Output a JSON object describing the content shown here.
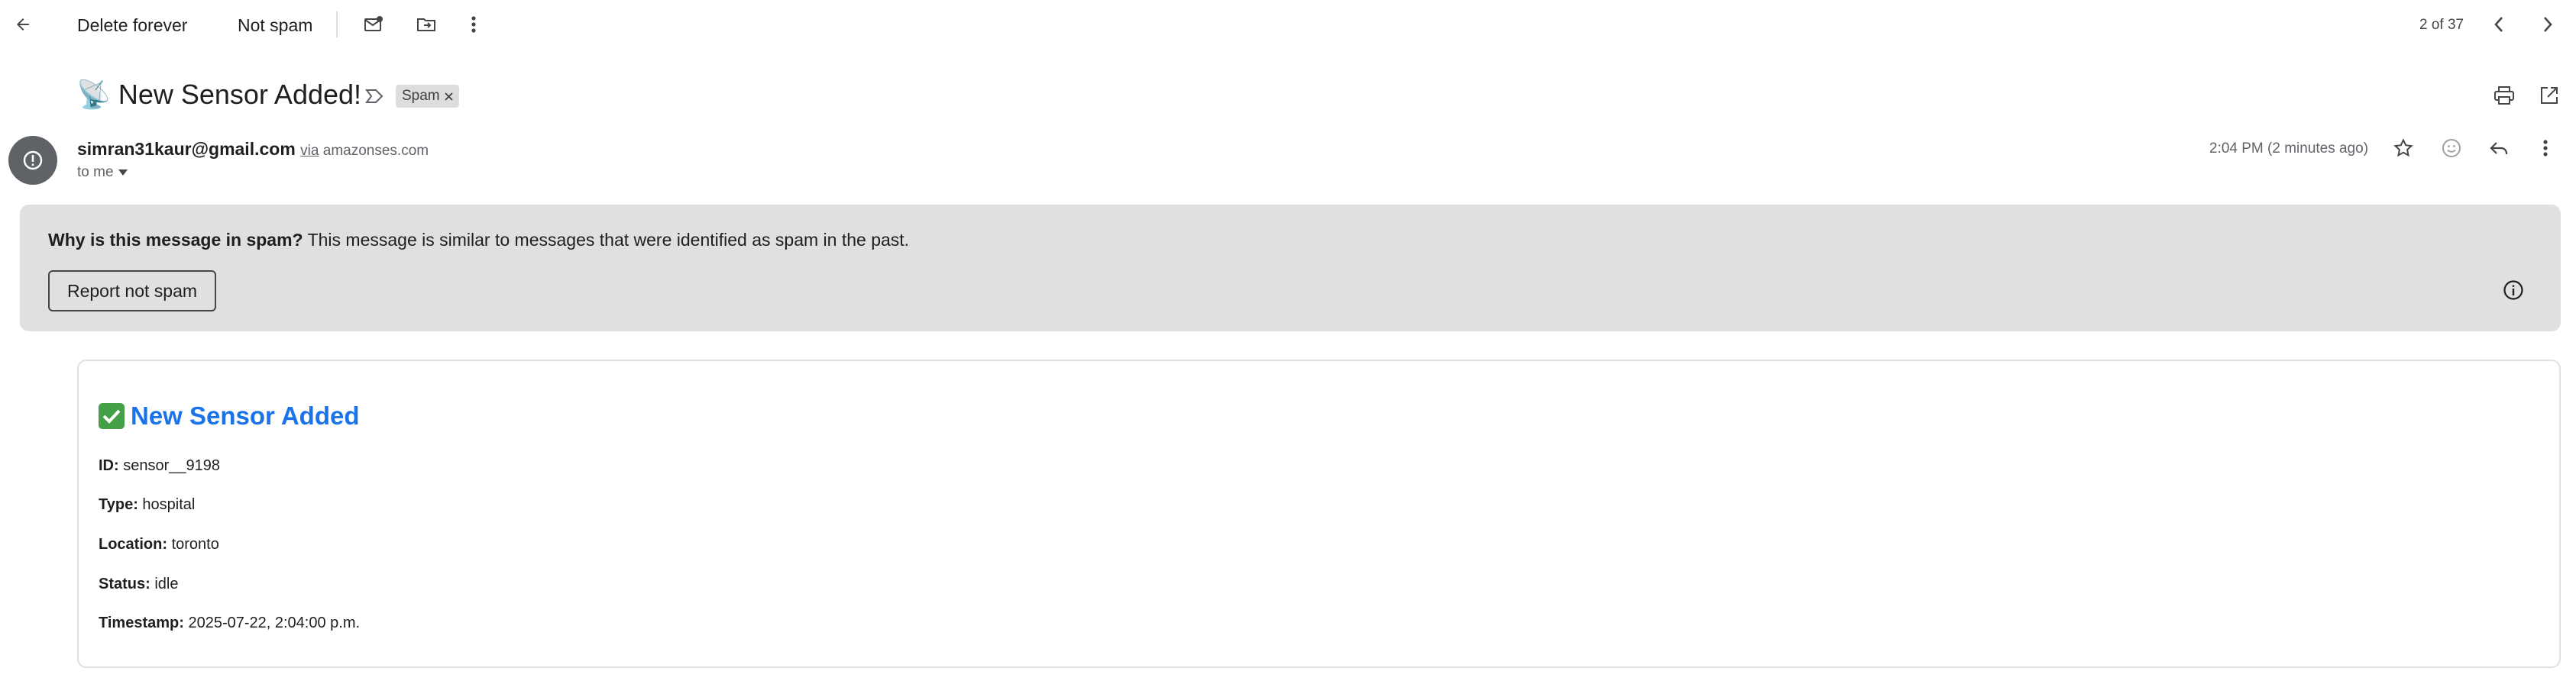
{
  "toolbar": {
    "delete_forever": "Delete forever",
    "not_spam": "Not spam",
    "pagination": "2 of 37"
  },
  "email": {
    "subject": "📡 New Sensor Added!",
    "label": "Spam",
    "sender": "simran31kaur@gmail.com",
    "via_word": "via",
    "via_domain": "amazonses.com",
    "to": "to me",
    "time": "2:04 PM (2 minutes ago)"
  },
  "spam_banner": {
    "question": "Why is this message in spam?",
    "explanation": "This message is similar to messages that were identified as spam in the past.",
    "report_button": "Report not spam"
  },
  "body": {
    "title": "New Sensor Added",
    "fields": [
      {
        "label": "ID:",
        "value": "sensor__9198"
      },
      {
        "label": "Type:",
        "value": "hospital"
      },
      {
        "label": "Location:",
        "value": "toronto"
      },
      {
        "label": "Status:",
        "value": "idle"
      },
      {
        "label": "Timestamp:",
        "value": "2025-07-22, 2:04:00 p.m."
      }
    ]
  },
  "icons": [
    "arrow-back-icon",
    "mark-unread-icon",
    "move-to-icon",
    "more-vert-icon",
    "chevron-left-icon",
    "chevron-right-icon",
    "label-outline-icon",
    "print-icon",
    "open-in-new-icon",
    "info-icon",
    "star-icon",
    "emoji-icon",
    "reply-icon",
    "chevron-down-icon",
    "check-mark-icon"
  ],
  "colors": {
    "accent": "#1a73e8",
    "banner_bg": "#e0e0e0",
    "avatar_bg": "#5f6368",
    "check_green": "#43a047"
  }
}
